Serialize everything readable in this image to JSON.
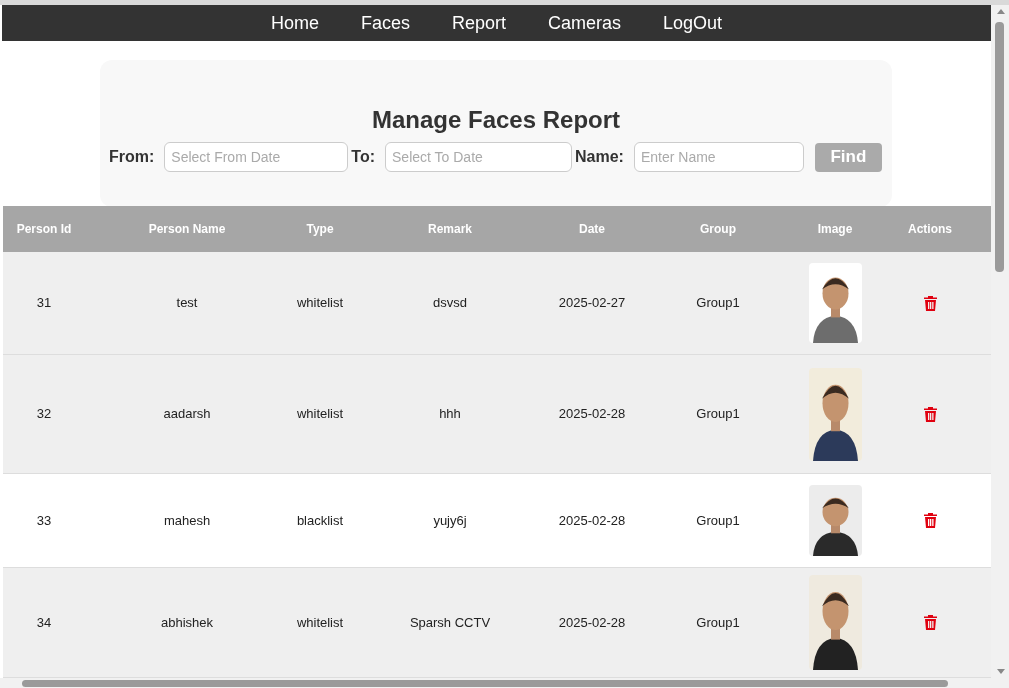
{
  "nav": [
    "Home",
    "Faces",
    "Report",
    "Cameras",
    "LogOut"
  ],
  "title": "Manage Faces Report",
  "filters": [
    {
      "label": "From:",
      "placeholder": "Select From Date"
    },
    {
      "label": "To:",
      "placeholder": "Select To Date"
    },
    {
      "label": "Name:",
      "placeholder": "Enter Name"
    }
  ],
  "find_button": "Find",
  "table": {
    "columns": [
      "Person Id",
      "Person Name",
      "Type",
      "Remark",
      "Date",
      "Group",
      "Image",
      "Actions"
    ],
    "rows": [
      {
        "id": "31",
        "name": "test",
        "type": "whitelist",
        "remark": "dsvsd",
        "date": "2025-02-27",
        "group": "Group1",
        "shaded": true
      },
      {
        "id": "32",
        "name": "aadarsh",
        "type": "whitelist",
        "remark": "hhh",
        "date": "2025-02-28",
        "group": "Group1",
        "shaded": true
      },
      {
        "id": "33",
        "name": "mahesh",
        "type": "blacklist",
        "remark": "yujy6j",
        "date": "2025-02-28",
        "group": "Group1",
        "shaded": false
      },
      {
        "id": "34",
        "name": "abhishek",
        "type": "whitelist",
        "remark": "Sparsh CCTV",
        "date": "2025-02-28",
        "group": "Group1",
        "shaded": true
      }
    ]
  }
}
